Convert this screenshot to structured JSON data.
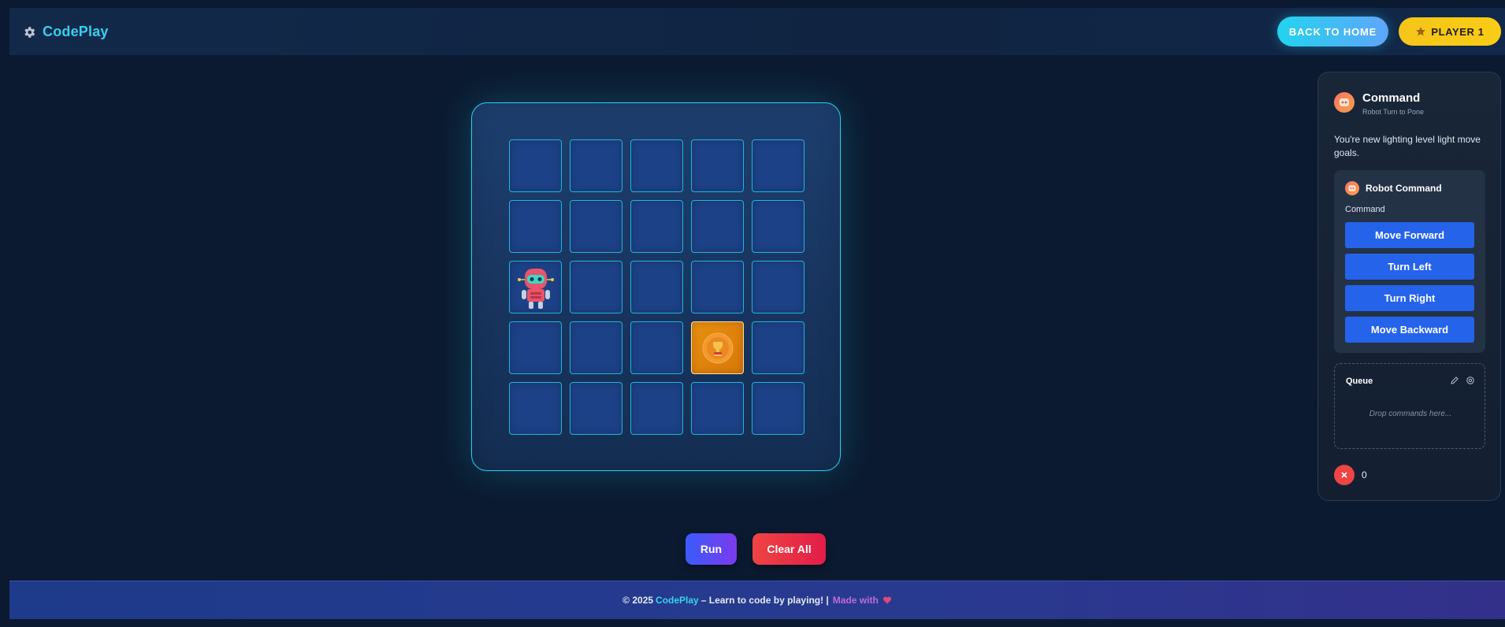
{
  "header": {
    "brand": "CodePlay",
    "back_home_label": "BACK TO HOME",
    "player_label": "PLAYER 1"
  },
  "board": {
    "rows": 5,
    "cols": 5,
    "robot_cell": {
      "row": 3,
      "col": 1
    },
    "goal_cell": {
      "row": 4,
      "col": 4
    }
  },
  "controls": {
    "run_label": "Run",
    "clear_label": "Clear All"
  },
  "panel": {
    "title": "Command",
    "subtitle": "Robot Turn to Pone",
    "description": "You're new lighting level light move goals.",
    "robot_command": {
      "title": "Robot Command",
      "label": "Command",
      "buttons": [
        "Move Forward",
        "Turn Left",
        "Turn Right",
        "Move Backward"
      ]
    },
    "queue": {
      "title": "Queue",
      "placeholder": "Drop commands here..."
    },
    "error_count": "0"
  },
  "footer": {
    "copyright": "© 2025",
    "brand": "CodePlay",
    "tagline": "– Learn to code by playing!  |",
    "made_with": "Made with"
  },
  "colors": {
    "accent": "#22d3ee",
    "background": "#0b1a30",
    "cell": "#1c4186",
    "goal": "#e8900f",
    "command_button": "#2563eb",
    "player_badge": "#facc15"
  }
}
